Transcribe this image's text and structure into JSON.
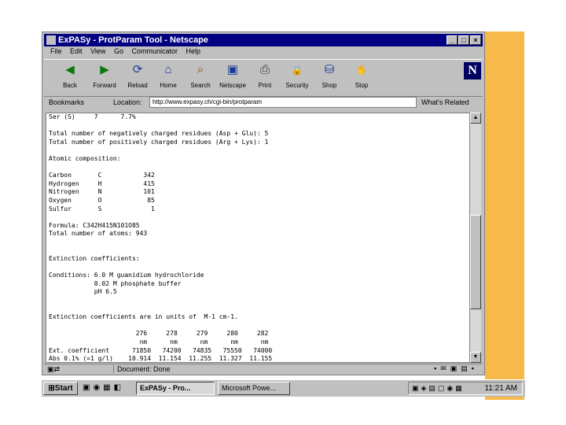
{
  "window": {
    "title": "ExPASy - ProtParam Tool - Netscape",
    "controls": [
      "_",
      "□",
      "×"
    ]
  },
  "menu": [
    "File",
    "Edit",
    "View",
    "Go",
    "Communicator",
    "Help"
  ],
  "toolbar": [
    {
      "label": "Back",
      "icon": "back-arrow-icon",
      "glyph": "◀"
    },
    {
      "label": "Forward",
      "icon": "forward-arrow-icon",
      "glyph": "▶"
    },
    {
      "label": "Reload",
      "icon": "reload-icon",
      "glyph": "⟳"
    },
    {
      "label": "Home",
      "icon": "home-icon",
      "glyph": "⌂"
    },
    {
      "label": "Search",
      "icon": "search-icon",
      "glyph": "⌕"
    },
    {
      "label": "Netscape",
      "icon": "netscape-icon",
      "glyph": "▣"
    },
    {
      "label": "Print",
      "icon": "print-icon",
      "glyph": "⎙"
    },
    {
      "label": "Security",
      "icon": "lock-icon",
      "glyph": "🔒"
    },
    {
      "label": "Shop",
      "icon": "shop-icon",
      "glyph": "⛁"
    },
    {
      "label": "Stop",
      "icon": "stop-icon",
      "glyph": "✋"
    }
  ],
  "logo": "N",
  "location": {
    "bookmarks_label": "Bookmarks",
    "location_label": "Location:",
    "url": "http://www.expasy.ch/cgi-bin/protparam",
    "related_label": "What's Related"
  },
  "content_lines": [
    "Ser (S)     7      7.7%",
    "",
    "Total number of negatively charged residues (Asp + Glu): 5",
    "Total number of positively charged residues (Arg + Lys): 1",
    "",
    "Atomic composition:",
    "",
    "Carbon       C           342",
    "Hydrogen     H           415",
    "Nitrogen     N           101",
    "Oxygen       O            85",
    "Sulfur       S             1",
    "",
    "Formula: C342H415N101O85",
    "Total number of atoms: 943",
    "",
    "",
    "Extinction coefficients:",
    "",
    "Conditions: 6.0 M guanidium hydrochloride",
    "            0.02 M phosphate buffer",
    "            pH 6.5",
    "",
    "",
    "Extinction coefficients are in units of  M-1 cm-1.",
    "",
    "                       276     278     279     280     282",
    "                        nm      nm      nm      nm      nm",
    "Ext. coefficient      71850   74200   74835   75550   74000",
    "Abs 0.1% (=1 g/l)    10.914  11.154  11.255  11.327  11.155"
  ],
  "status": {
    "message": "Document: Done"
  },
  "taskbar": {
    "start_label": "Start",
    "tasks": [
      "ExPASy - Pro...",
      "Microsoft Powe..."
    ],
    "clock": "11:21 AM"
  },
  "colors": {
    "accent_stripe": "#f6b94a",
    "titlebar": "#000080",
    "chrome": "#c0c0c0"
  }
}
